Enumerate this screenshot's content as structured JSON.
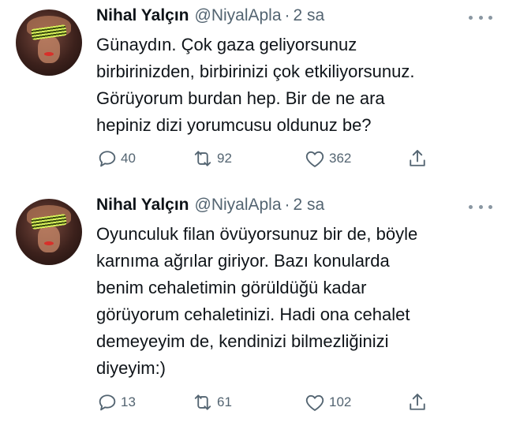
{
  "colors": {
    "text": "#0f1419",
    "secondary": "#536471",
    "background": "#ffffff"
  },
  "tweets": [
    {
      "author": {
        "name": "Nihal Yalçın",
        "handle": "@NiyalApla",
        "separator": "·",
        "time": "2 sa"
      },
      "lines": [
        "Günaydın. Çok gaza geliyorsunuz",
        "birbirinizden, birbirinizi çok etkiliyorsunuz.",
        "Görüyorum burdan hep. Bir de ne ara",
        "hepiniz dizi yorumcusu oldunuz be?"
      ],
      "stats": {
        "replies": "40",
        "retweets": "92",
        "likes": "362"
      },
      "icons": [
        "reply-icon",
        "retweet-icon",
        "like-icon",
        "share-icon",
        "more-icon"
      ]
    },
    {
      "author": {
        "name": "Nihal Yalçın",
        "handle": "@NiyalApla",
        "separator": "·",
        "time": "2 sa"
      },
      "lines": [
        "Oyunculuk filan övüyorsunuz bir de, böyle",
        "karnıma ağrılar giriyor. Bazı konularda",
        "benim cehaletimin görüldüğü kadar",
        "görüyorum cehaletinizi. Hadi ona cehalet",
        "demeyeyim de, kendinizi bilmezliğinizi",
        "diyeyim:)"
      ],
      "stats": {
        "replies": "13",
        "retweets": "61",
        "likes": "102"
      },
      "icons": [
        "reply-icon",
        "retweet-icon",
        "like-icon",
        "share-icon",
        "more-icon"
      ]
    }
  ]
}
